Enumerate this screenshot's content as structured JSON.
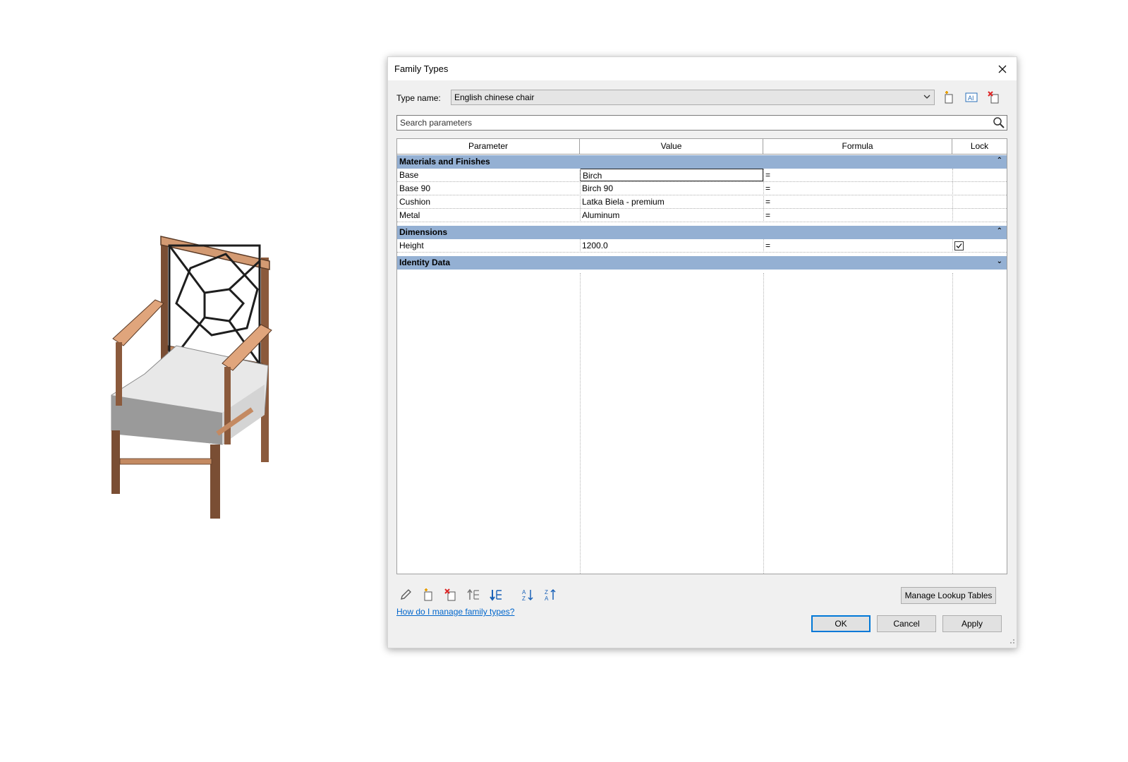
{
  "dialog": {
    "title": "Family Types",
    "type_name_label": "Type name:",
    "type_name_value": "English chinese chair",
    "search_placeholder": "Search parameters",
    "columns": [
      "Parameter",
      "Value",
      "Formula",
      "Lock"
    ],
    "groups": [
      {
        "label": "Materials and Finishes",
        "expanded": true,
        "rows": [
          {
            "parameter": "Base",
            "value": "Birch",
            "formula": "=",
            "locked": null
          },
          {
            "parameter": "Base 90",
            "value": "Birch 90",
            "formula": "=",
            "locked": null
          },
          {
            "parameter": "Cushion",
            "value": "Latka Biela - premium",
            "formula": "=",
            "locked": null
          },
          {
            "parameter": "Metal",
            "value": "Aluminum",
            "formula": "=",
            "locked": null
          }
        ]
      },
      {
        "label": "Dimensions",
        "expanded": true,
        "rows": [
          {
            "parameter": "Height",
            "value": "1200.0",
            "formula": "=",
            "locked": true
          }
        ]
      },
      {
        "label": "Identity Data",
        "expanded": false,
        "rows": []
      }
    ],
    "manage_lookup_label": "Manage Lookup Tables",
    "help_link": "How do I manage family types?",
    "ok_label": "OK",
    "cancel_label": "Cancel",
    "apply_label": "Apply"
  },
  "colors": {
    "group_header": "#94b0d3",
    "accent": "#0078d7",
    "link": "#0066cc",
    "chair_wood": "#c48a62"
  },
  "icons": {
    "type_toolbar": [
      "new-type-icon",
      "rename-type-icon",
      "delete-type-icon"
    ],
    "param_toolbar": [
      "edit-parameter-icon",
      "new-parameter-icon",
      "delete-parameter-icon",
      "move-up-icon",
      "move-down-icon",
      "sort-ascending-icon",
      "sort-descending-icon"
    ]
  }
}
